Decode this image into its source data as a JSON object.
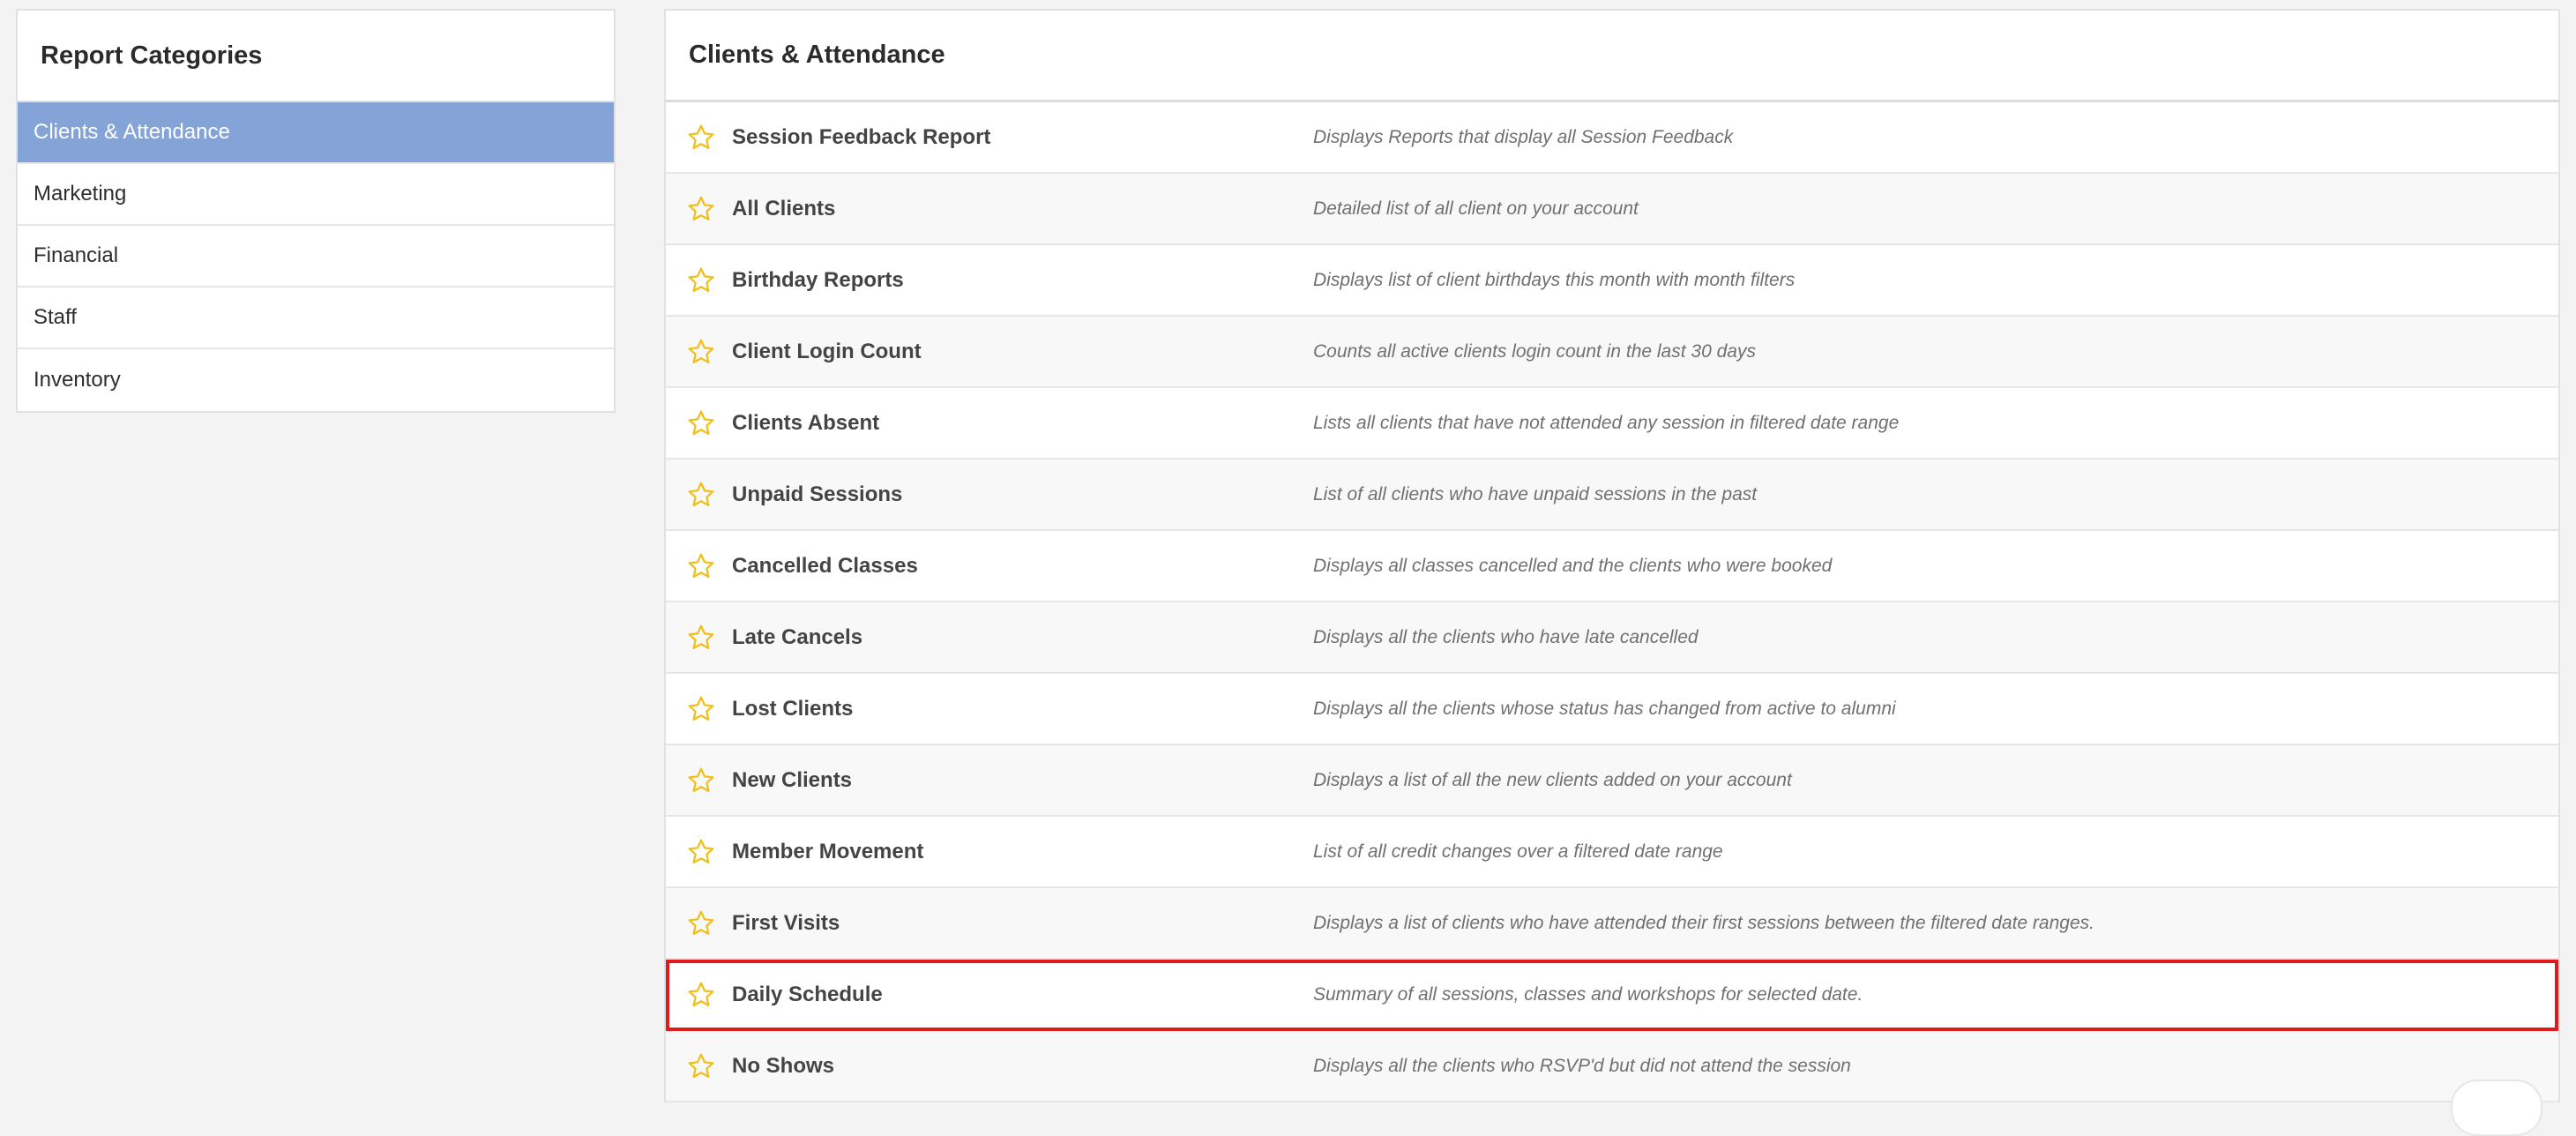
{
  "sidebar": {
    "title": "Report Categories",
    "items": [
      {
        "label": "Clients & Attendance",
        "active": true
      },
      {
        "label": "Marketing",
        "active": false
      },
      {
        "label": "Financial",
        "active": false
      },
      {
        "label": "Staff",
        "active": false
      },
      {
        "label": "Inventory",
        "active": false
      }
    ]
  },
  "main": {
    "title": "Clients & Attendance",
    "reports": [
      {
        "name": "Session Feedback Report",
        "description": "Displays Reports that display all Session Feedback"
      },
      {
        "name": "All Clients",
        "description": "Detailed list of all client on your account"
      },
      {
        "name": "Birthday Reports",
        "description": "Displays list of client birthdays this month with month filters"
      },
      {
        "name": "Client Login Count",
        "description": "Counts all active clients login count in the last 30 days"
      },
      {
        "name": "Clients Absent",
        "description": "Lists all clients that have not attended any session in filtered date range"
      },
      {
        "name": "Unpaid Sessions",
        "description": "List of all clients who have unpaid sessions in the past"
      },
      {
        "name": "Cancelled Classes",
        "description": "Displays all classes cancelled and the clients who were booked"
      },
      {
        "name": "Late Cancels",
        "description": "Displays all the clients who have late cancelled"
      },
      {
        "name": "Lost Clients",
        "description": "Displays all the clients whose status has changed from active to alumni"
      },
      {
        "name": "New Clients",
        "description": "Displays a list of all the new clients added on your account"
      },
      {
        "name": "Member Movement",
        "description": "List of all credit changes over a filtered date range"
      },
      {
        "name": "First Visits",
        "description": "Displays a list of clients who have attended their first sessions between the filtered date ranges."
      },
      {
        "name": "Daily Schedule",
        "description": "Summary of all sessions, classes and workshops for selected date."
      },
      {
        "name": "No Shows",
        "description": "Displays all the clients who RSVP'd but did not attend the session"
      }
    ]
  },
  "colors": {
    "active_category": "#84a3d6",
    "star": "#f0bf1a",
    "highlight": "#e11b1b"
  },
  "icons": {
    "favorite": "star-outline-icon"
  }
}
